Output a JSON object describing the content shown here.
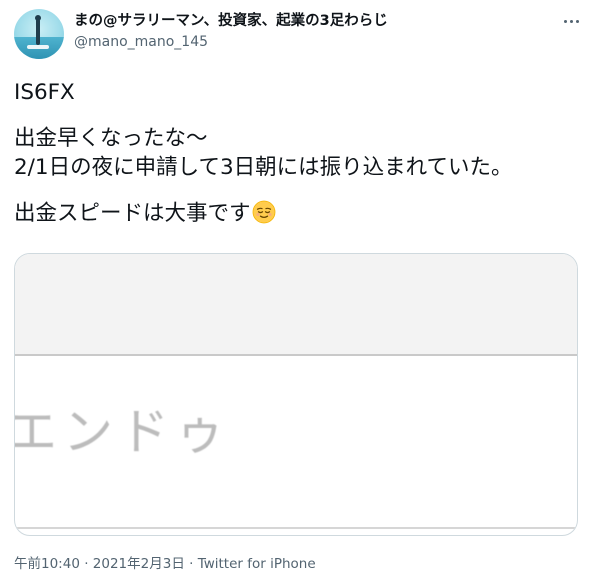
{
  "author": {
    "display_name": "まの@サラリーマン、投資家、起業の3足わらじ",
    "handle": "@mano_mano_145"
  },
  "tweet": {
    "line1": "IS6FX",
    "line2": "出金早くなったな～",
    "line3": "2/1日の夜に申請して3日朝には振り込まれていた。",
    "line4": "出金スピードは大事です",
    "emoji_name": "relieved-face"
  },
  "media": {
    "visible_text": "エンドゥ"
  },
  "meta": {
    "time": "午前10:40",
    "separator1": " · ",
    "date": "2021年2月3日",
    "separator2": " · ",
    "source": "Twitter for iPhone"
  },
  "colors": {
    "text_primary": "#0f1419",
    "text_secondary": "#536471",
    "border": "#cfd9de",
    "emoji_face": "#ffcc4d"
  },
  "icons": {
    "more": "more-horizontal-icon"
  }
}
